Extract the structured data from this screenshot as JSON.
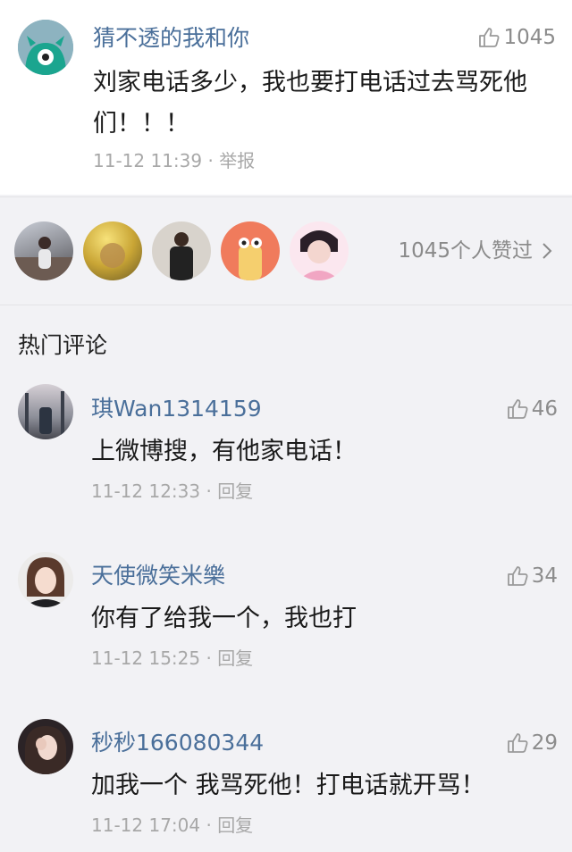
{
  "main_comment": {
    "username": "猜不透的我和你",
    "likes": "1045",
    "text": "刘家电话多少，我也要打电话过去骂死他们！！！",
    "time": "11-12 11:39",
    "action": "举报",
    "avatar_icon": "teal-monster-avatar"
  },
  "likers": {
    "count_label": "1045个人赞过",
    "arrow_icon": "chevron-right-icon",
    "avatars": [
      "liker-avatar-1",
      "liker-avatar-2",
      "liker-avatar-3",
      "liker-avatar-4",
      "liker-avatar-5"
    ]
  },
  "hot_comments": {
    "title": "热门评论",
    "items": [
      {
        "username": "琪Wan1314159",
        "likes": "46",
        "text": "上微博搜，有他家电话！",
        "time": "11-12 12:33",
        "action": "回复"
      },
      {
        "username": "天使微笑米樂",
        "likes": "34",
        "text": "你有了给我一个，我也打",
        "time": "11-12 15:25",
        "action": "回复"
      },
      {
        "username": "秒秒166080344",
        "likes": "29",
        "text": "加我一个 我骂死他！打电话就开骂！",
        "time": "11-12 17:04",
        "action": "回复"
      }
    ]
  },
  "colors": {
    "username": "#4a6f9a",
    "meta": "#a8a8a8",
    "background": "#f2f2f5"
  }
}
